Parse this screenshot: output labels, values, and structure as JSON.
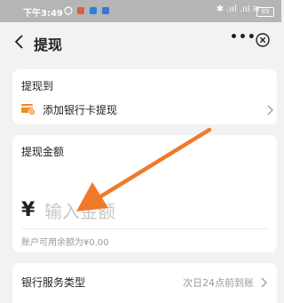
{
  "status_bar": {
    "time": "下午3:49",
    "battery": "85"
  },
  "nav": {
    "title": "提现",
    "more_label": "•••"
  },
  "withdraw_to": {
    "label": "提现到",
    "bank_action": "添加银行卡提现"
  },
  "amount": {
    "label": "提现金额",
    "currency": "¥",
    "placeholder": "输入金额",
    "balance_text": "账户可用余额为¥0.00"
  },
  "service": {
    "label": "银行服务类型",
    "value": "次日24点前到账"
  },
  "colors": {
    "accent_orange": "#f08a24",
    "arrow_orange": "#f07a2a"
  }
}
